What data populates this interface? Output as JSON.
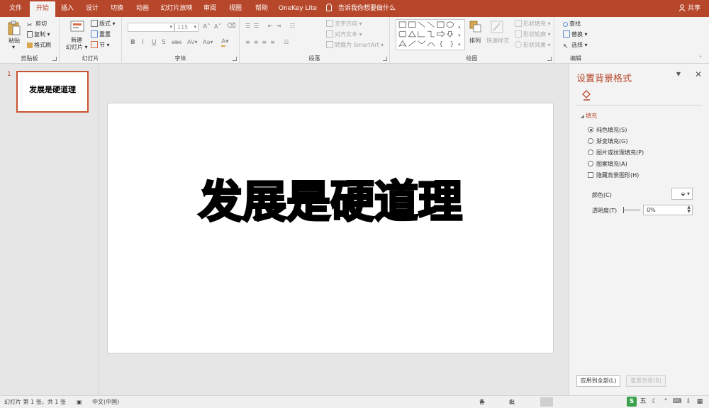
{
  "tabs": [
    {
      "label": "文件",
      "active": false
    },
    {
      "label": "开始",
      "active": true
    },
    {
      "label": "插入",
      "active": false
    },
    {
      "label": "设计",
      "active": false
    },
    {
      "label": "切换",
      "active": false
    },
    {
      "label": "动画",
      "active": false
    },
    {
      "label": "幻灯片放映",
      "active": false
    },
    {
      "label": "审阅",
      "active": false
    },
    {
      "label": "视图",
      "active": false
    },
    {
      "label": "帮助",
      "active": false
    },
    {
      "label": "OneKey Lite",
      "active": false
    }
  ],
  "tell_me": "告诉我你想要做什么",
  "share": "共享",
  "ribbon": {
    "clipboard": {
      "title": "剪贴板",
      "paste": "粘贴",
      "cut": "剪切",
      "copy": "复制",
      "format_painter": "格式刷"
    },
    "slides": {
      "title": "幻灯片",
      "new_slide": "新建",
      "new_slide2": "幻灯片",
      "layout": "版式",
      "reset": "重置",
      "section": "节"
    },
    "font": {
      "title": "字体",
      "size": "115",
      "bold": "B",
      "italic": "I",
      "underline": "U",
      "shadow": "S",
      "strike": "abc",
      "spacing": "AV",
      "case": "Aa",
      "grow": "A",
      "shrink": "A"
    },
    "paragraph": {
      "title": "段落",
      "text_direction": "文字方向",
      "align_text": "对齐文本",
      "smartart": "转换为 SmartArt"
    },
    "drawing": {
      "title": "绘图",
      "arrange": "排列",
      "quick_styles": "快速样式",
      "shape_fill": "形状填充",
      "shape_outline": "形状轮廓",
      "shape_effects": "形状效果"
    },
    "editing": {
      "title": "编辑",
      "find": "查找",
      "replace": "替换",
      "select": "选择"
    }
  },
  "thumbnail": {
    "number": "1",
    "text": "发展是硬道理"
  },
  "slide": {
    "title": "发展是硬道理"
  },
  "format_pane": {
    "title": "设置背景格式",
    "section": "填充",
    "options": [
      {
        "label": "纯色填充(S)",
        "selected": true
      },
      {
        "label": "渐变填充(G)",
        "selected": false
      },
      {
        "label": "图片或纹理填充(P)",
        "selected": false
      },
      {
        "label": "图案填充(A)",
        "selected": false
      }
    ],
    "hide_graphics": "隐藏背景图形(H)",
    "color_label": "颜色(C)",
    "transparency_label": "透明度(T)",
    "transparency_value": "0%",
    "apply_all": "应用到全部(L)",
    "reset_background": "重置背景(B)"
  },
  "status": {
    "slide_info": "幻灯片 第 1 张，共 1 张",
    "language": "中文(中国)",
    "notes": "备注",
    "comments": "批注"
  },
  "colors": {
    "accent": "#b7472a"
  }
}
